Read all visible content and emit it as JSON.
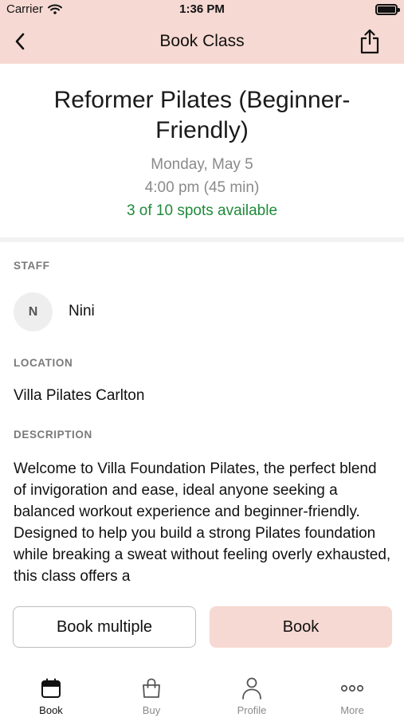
{
  "status_bar": {
    "carrier": "Carrier",
    "time": "1:36 PM"
  },
  "nav": {
    "title": "Book Class",
    "back_icon": "chevron-left-icon",
    "share_icon": "share-icon"
  },
  "class": {
    "title": "Reformer Pilates (Beginner-Friendly)",
    "date": "Monday, May 5",
    "time": "4:00 pm (45 min)",
    "spots": "3 of 10 spots available"
  },
  "staff": {
    "label": "STAFF",
    "initial": "N",
    "name": "Nini"
  },
  "location": {
    "label": "LOCATION",
    "value": "Villa Pilates Carlton"
  },
  "description": {
    "label": "DESCRIPTION",
    "text": "Welcome to Villa Foundation Pilates, the perfect blend of invigoration and ease, ideal anyone seeking a balanced workout experience and beginner-friendly. Designed to help you build a strong Pilates foundation while breaking a sweat without feeling overly exhausted, this class offers a"
  },
  "actions": {
    "book_multiple": "Book multiple",
    "book": "Book"
  },
  "tabs": [
    {
      "label": "Book",
      "icon": "calendar-icon",
      "active": true
    },
    {
      "label": "Buy",
      "icon": "bag-icon",
      "active": false
    },
    {
      "label": "Profile",
      "icon": "person-icon",
      "active": false
    },
    {
      "label": "More",
      "icon": "more-icon",
      "active": false
    }
  ],
  "colors": {
    "accent": "#f6d9d2",
    "available": "#1f8a3a",
    "muted": "#8a8a8a"
  }
}
